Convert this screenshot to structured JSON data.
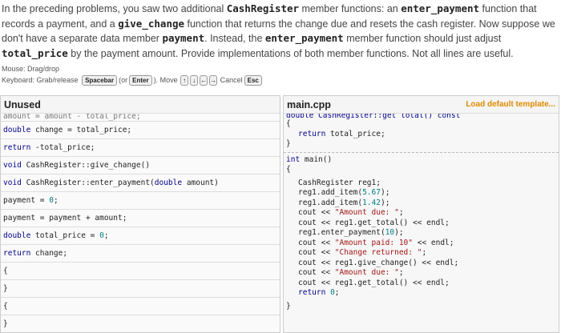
{
  "intro": {
    "p1": "In the preceding problems, you saw two additional ",
    "c1": "CashRegister",
    "p2": " member functions: an ",
    "c2": "enter_payment",
    "p3": " function that records a payment, and a ",
    "c3": "give_change",
    "p4": " function that returns the change due and resets the cash register. Now suppose we don't have a separate data member ",
    "c4": "payment",
    "p5": ". Instead, the ",
    "c5": "enter_payment",
    "p6": " member function should just adjust ",
    "c6": "total_price",
    "p7": " by the payment amount. Provide implementations of both member functions. Not all lines are useful."
  },
  "help": {
    "mouse": "Mouse: Drag/drop",
    "keyboard_prefix": "Keyboard: Grab/release",
    "spacebar": "Spacebar",
    "or_text": "(or",
    "enter": "Enter",
    "close_paren": ").",
    "move_text": "Move",
    "up": "↑",
    "down": "↓",
    "left": "←",
    "right": "→",
    "cancel_text": "Cancel",
    "esc": "Esc"
  },
  "unused": {
    "title": "Unused",
    "items": [
      "amount = amount - total_price;",
      "double change = total_price;",
      "return -total_price;",
      "void CashRegister::give_change()",
      "void CashRegister::enter_payment(double amount)",
      "payment = 0;",
      "payment = payment + amount;",
      "double total_price = 0;",
      "return change;",
      "{",
      "}",
      "{",
      "}"
    ]
  },
  "editor": {
    "title": "main.cpp",
    "load_label": "Load default template...",
    "top_partial": "double CashRegister::get_total() const",
    "open_brace": "{",
    "return_total": "return total_price;",
    "close_brace": "}",
    "main_sig": "int main()",
    "main_open": "{",
    "main_lines": [
      "CashRegister reg1;",
      "reg1.add_item(5.67);",
      "reg1.add_item(1.42);",
      "cout << \"Amount due: \";",
      "cout << reg1.get_total() << endl;",
      "reg1.enter_payment(10);",
      "cout << \"Amount paid: 10\" << endl;",
      "cout << \"Change returned: \";",
      "cout << reg1.give_change() << endl;",
      "cout << \"Amount due: \";",
      "cout << reg1.get_total() << endl;",
      "return 0;"
    ],
    "main_close": "}"
  }
}
